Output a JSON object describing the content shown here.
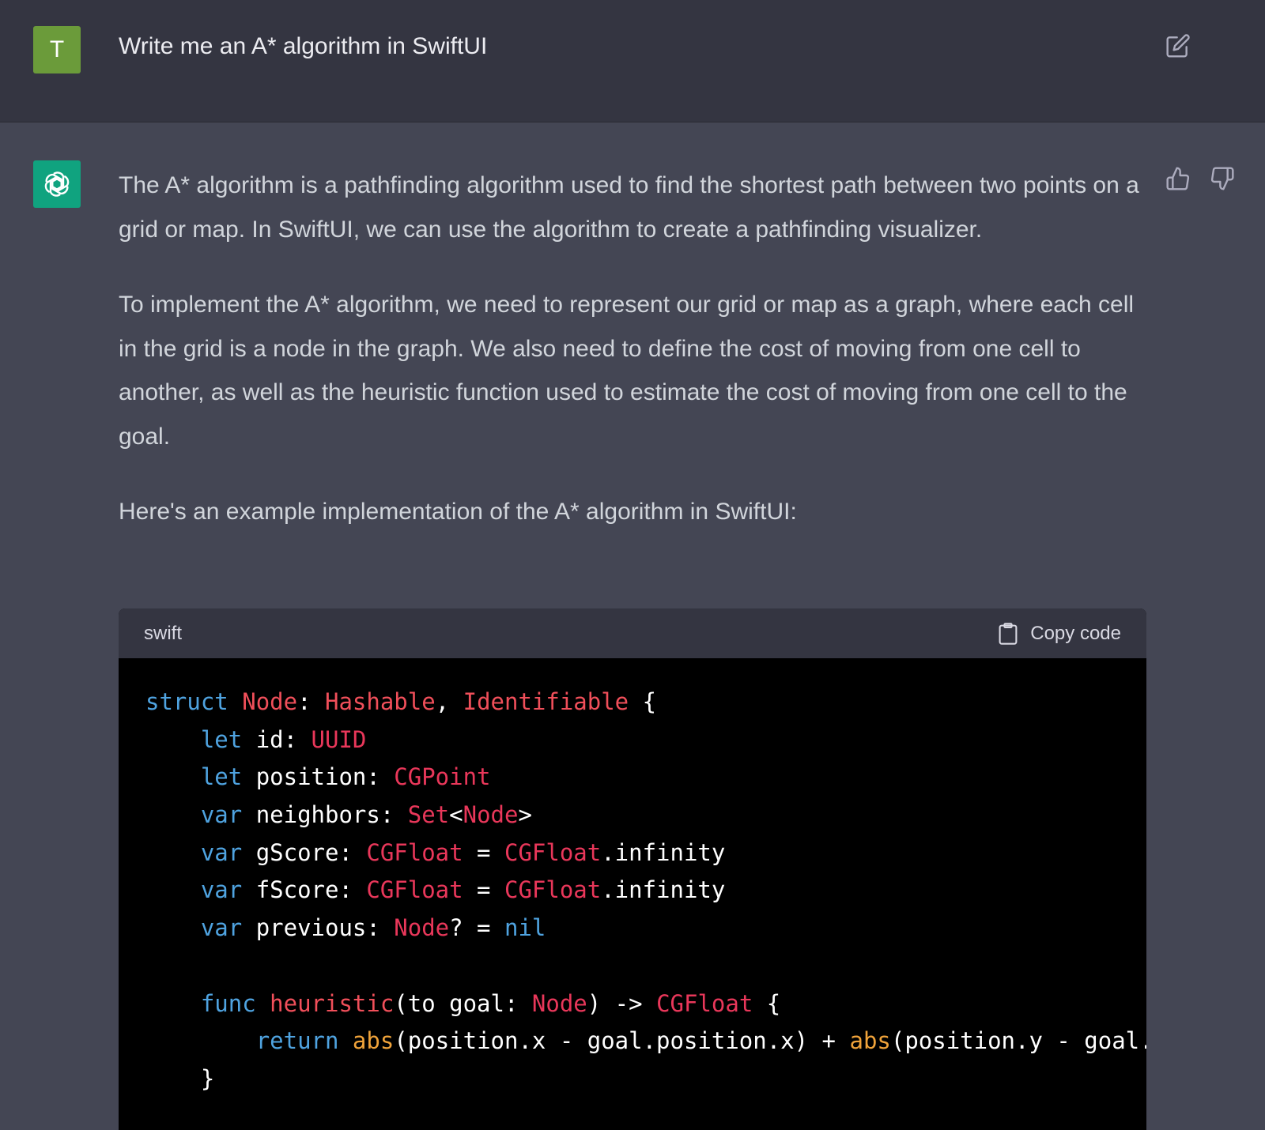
{
  "user": {
    "avatar_letter": "T",
    "message": "Write me an A* algorithm in SwiftUI"
  },
  "assistant": {
    "paragraphs": [
      "The A* algorithm is a pathfinding algorithm used to find the shortest path between two points on a grid or map. In SwiftUI, we can use the algorithm to create a pathfinding visualizer.",
      "To implement the A* algorithm, we need to represent our grid or map as a graph, where each cell in the grid is a node in the graph. We also need to define the cost of moving from one cell to another, as well as the heuristic function used to estimate the cost of moving from one cell to the goal.",
      "Here's an example implementation of the A* algorithm in SwiftUI:"
    ],
    "code": {
      "language": "swift",
      "copy_label": "Copy code",
      "lines": [
        "struct Node: Hashable, Identifiable {",
        "    let id: UUID",
        "    let position: CGPoint",
        "    var neighbors: Set<Node>",
        "    var gScore: CGFloat = CGFloat.infinity",
        "    var fScore: CGFloat = CGFloat.infinity",
        "    var previous: Node? = nil",
        "",
        "    func heuristic(to goal: Node) -> CGFloat {",
        "        return abs(position.x - goal.position.x) + abs(position.y - goal.position.y)",
        "    }"
      ]
    }
  },
  "icons": {
    "edit": "edit-icon",
    "thumbs_up": "thumbs-up-icon",
    "thumbs_down": "thumbs-down-icon",
    "assistant_logo": "openai-logo-icon",
    "clipboard": "clipboard-icon"
  },
  "colors": {
    "background": "#444654",
    "user_row": "#343541",
    "user_avatar": "#6b9b3a",
    "assistant_avatar": "#10a37f",
    "code_bg": "#000000",
    "keyword": "#4fa3e0",
    "type": "#e9375a",
    "function": "#f04f5a",
    "builtin": "#f0a33a"
  }
}
